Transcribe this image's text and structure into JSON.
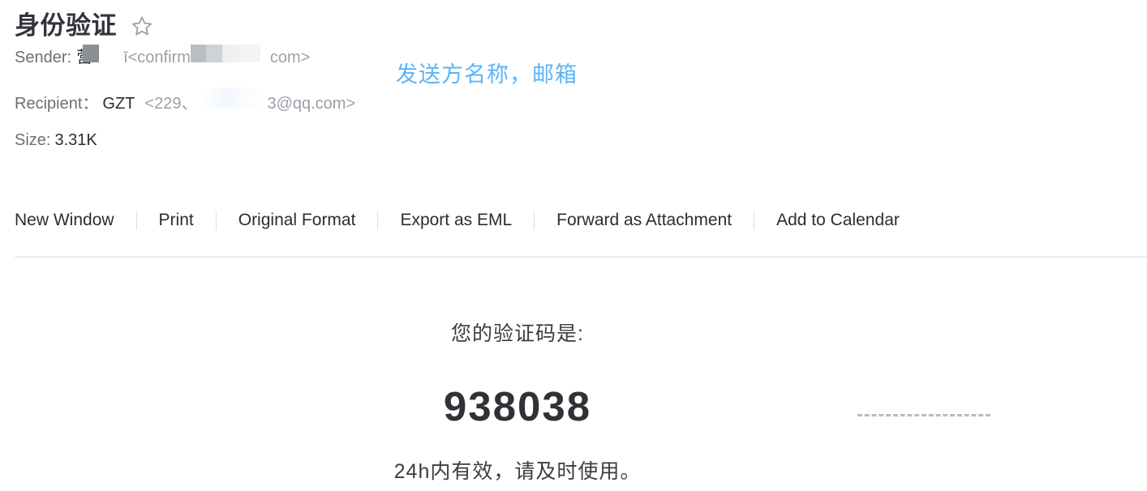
{
  "mail": {
    "subject": "身份验证",
    "star_icon": "star-outline-icon",
    "sender": {
      "label": "Sender:",
      "name_visible": "营",
      "name_tail": "ī",
      "address_prefix": "<confirm",
      "address_suffix": "com>"
    },
    "recipient": {
      "label": "Recipient：",
      "name": "GZT",
      "address_prefix": "<229、",
      "address_suffix": "3@qq.com>"
    },
    "size": {
      "label": "Size:",
      "value": "3.31K"
    }
  },
  "annotation": {
    "text": "发送方名称，邮箱",
    "color": "#5cb4f5"
  },
  "toolbar": {
    "items": [
      {
        "label": "New Window",
        "name": "new-window"
      },
      {
        "label": "Print",
        "name": "print"
      },
      {
        "label": "Original Format",
        "name": "original-format"
      },
      {
        "label": "Export as EML",
        "name": "export-as-eml"
      },
      {
        "label": "Forward as Attachment",
        "name": "forward-as-attachment"
      },
      {
        "label": "Add to Calendar",
        "name": "add-to-calendar"
      }
    ]
  },
  "body": {
    "intro": "您的验证码是:",
    "code": "938038",
    "note": "24h内有效，请及时使用。"
  },
  "colors": {
    "background": "#ffffff",
    "text_primary": "#2b2d31",
    "text_muted": "#9aa0a8",
    "divider": "#eceef0",
    "accent_blue": "#5cb4f5"
  }
}
